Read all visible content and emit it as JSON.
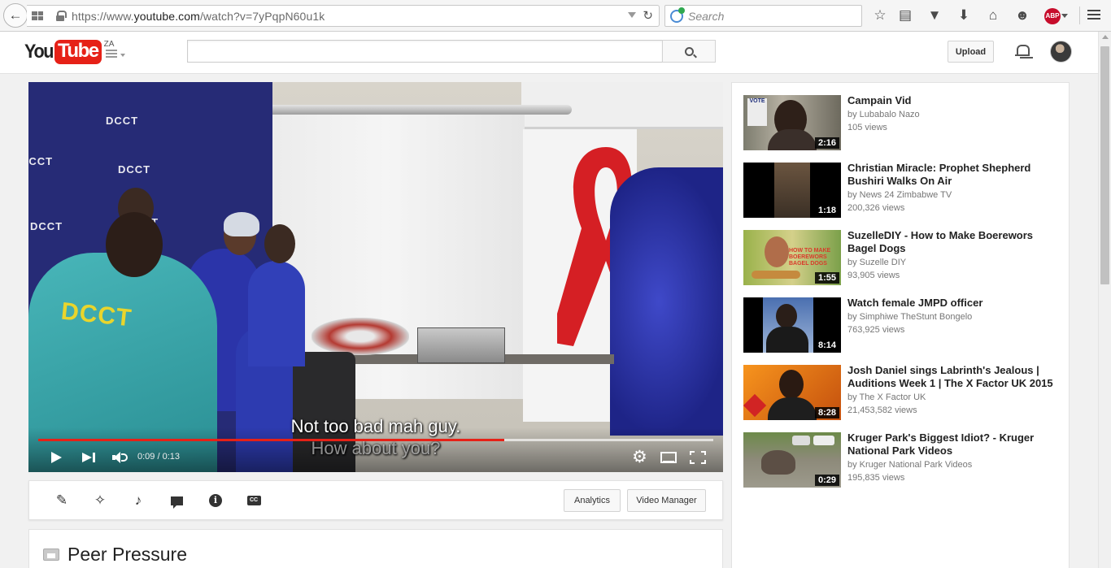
{
  "browser": {
    "url_prefix": "https://www.",
    "url_domain": "youtube.com",
    "url_path": "/watch?v=7yPqpN60u1k",
    "search_placeholder": "Search",
    "abp_label": "ABP"
  },
  "header": {
    "logo_you": "You",
    "logo_tube": "Tube",
    "country_code": "ZA",
    "search_value": "",
    "upload_label": "Upload"
  },
  "player": {
    "subtitle_line1": "Not too bad mah guy.",
    "subtitle_line2": "How about you?",
    "time_display": "0:09 / 0:13",
    "progress_fraction": 0.69,
    "buffered_fraction": 1.0,
    "backdrop_text": "DCCT",
    "shirt_text": "DCCT",
    "accent_color": "#e62117"
  },
  "creator_bar": {
    "icons": [
      "pencil-icon",
      "magic-wand-icon",
      "music-note-icon",
      "annotation-icon",
      "info-icon",
      "captions-icon"
    ],
    "info_glyph": "i",
    "cc_glyph": "CC",
    "analytics_label": "Analytics",
    "video_manager_label": "Video Manager"
  },
  "video": {
    "title": "Peer Pressure"
  },
  "recommendations": [
    {
      "title": "Campain Vid",
      "channel": "by Lubabalo Nazo",
      "views": "105 views",
      "duration": "2:16",
      "thumb_text": "VOTE"
    },
    {
      "title": "Christian Miracle: Prophet Shepherd Bushiri Walks On Air",
      "channel": "by News 24 Zimbabwe TV",
      "views": "200,326 views",
      "duration": "1:18"
    },
    {
      "title": "SuzelleDIY - How to Make Boerewors Bagel Dogs",
      "channel": "by Suzelle DIY",
      "views": "93,905 views",
      "duration": "1:55",
      "thumb_text": "HOW TO MAKE BOEREWORS BAGEL DOGS"
    },
    {
      "title": "Watch female JMPD officer",
      "channel": "by Simphiwe TheStunt Bongelo",
      "views": "763,925 views",
      "duration": "8:14"
    },
    {
      "title": "Josh Daniel sings Labrinth's Jealous | Auditions Week 1 | The X Factor UK 2015",
      "channel": "by The X Factor UK",
      "views": "21,453,582 views",
      "duration": "8:28"
    },
    {
      "title": "Kruger Park's Biggest Idiot? - Kruger National Park Videos",
      "channel": "by Kruger National Park Videos",
      "views": "195,835 views",
      "duration": "0:29"
    }
  ]
}
